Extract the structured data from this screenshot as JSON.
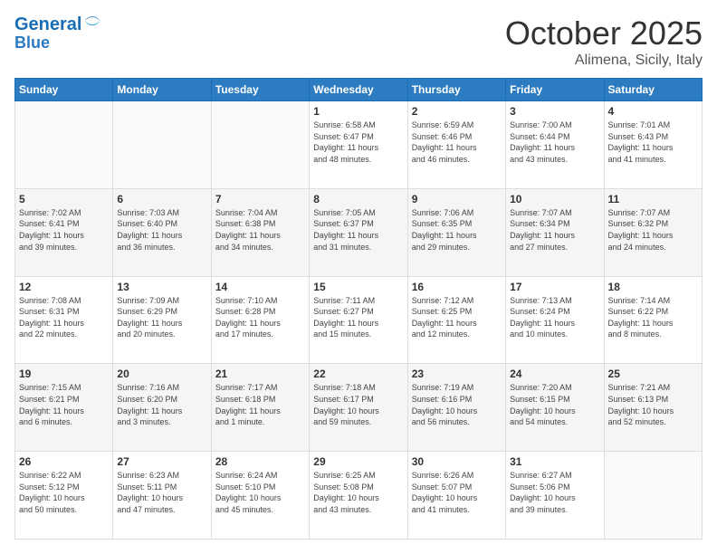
{
  "header": {
    "logo_line1": "General",
    "logo_line2": "Blue",
    "month": "October 2025",
    "location": "Alimena, Sicily, Italy"
  },
  "days_of_week": [
    "Sunday",
    "Monday",
    "Tuesday",
    "Wednesday",
    "Thursday",
    "Friday",
    "Saturday"
  ],
  "weeks": [
    [
      {
        "day": "",
        "info": ""
      },
      {
        "day": "",
        "info": ""
      },
      {
        "day": "",
        "info": ""
      },
      {
        "day": "1",
        "info": "Sunrise: 6:58 AM\nSunset: 6:47 PM\nDaylight: 11 hours\nand 48 minutes."
      },
      {
        "day": "2",
        "info": "Sunrise: 6:59 AM\nSunset: 6:46 PM\nDaylight: 11 hours\nand 46 minutes."
      },
      {
        "day": "3",
        "info": "Sunrise: 7:00 AM\nSunset: 6:44 PM\nDaylight: 11 hours\nand 43 minutes."
      },
      {
        "day": "4",
        "info": "Sunrise: 7:01 AM\nSunset: 6:43 PM\nDaylight: 11 hours\nand 41 minutes."
      }
    ],
    [
      {
        "day": "5",
        "info": "Sunrise: 7:02 AM\nSunset: 6:41 PM\nDaylight: 11 hours\nand 39 minutes."
      },
      {
        "day": "6",
        "info": "Sunrise: 7:03 AM\nSunset: 6:40 PM\nDaylight: 11 hours\nand 36 minutes."
      },
      {
        "day": "7",
        "info": "Sunrise: 7:04 AM\nSunset: 6:38 PM\nDaylight: 11 hours\nand 34 minutes."
      },
      {
        "day": "8",
        "info": "Sunrise: 7:05 AM\nSunset: 6:37 PM\nDaylight: 11 hours\nand 31 minutes."
      },
      {
        "day": "9",
        "info": "Sunrise: 7:06 AM\nSunset: 6:35 PM\nDaylight: 11 hours\nand 29 minutes."
      },
      {
        "day": "10",
        "info": "Sunrise: 7:07 AM\nSunset: 6:34 PM\nDaylight: 11 hours\nand 27 minutes."
      },
      {
        "day": "11",
        "info": "Sunrise: 7:07 AM\nSunset: 6:32 PM\nDaylight: 11 hours\nand 24 minutes."
      }
    ],
    [
      {
        "day": "12",
        "info": "Sunrise: 7:08 AM\nSunset: 6:31 PM\nDaylight: 11 hours\nand 22 minutes."
      },
      {
        "day": "13",
        "info": "Sunrise: 7:09 AM\nSunset: 6:29 PM\nDaylight: 11 hours\nand 20 minutes."
      },
      {
        "day": "14",
        "info": "Sunrise: 7:10 AM\nSunset: 6:28 PM\nDaylight: 11 hours\nand 17 minutes."
      },
      {
        "day": "15",
        "info": "Sunrise: 7:11 AM\nSunset: 6:27 PM\nDaylight: 11 hours\nand 15 minutes."
      },
      {
        "day": "16",
        "info": "Sunrise: 7:12 AM\nSunset: 6:25 PM\nDaylight: 11 hours\nand 12 minutes."
      },
      {
        "day": "17",
        "info": "Sunrise: 7:13 AM\nSunset: 6:24 PM\nDaylight: 11 hours\nand 10 minutes."
      },
      {
        "day": "18",
        "info": "Sunrise: 7:14 AM\nSunset: 6:22 PM\nDaylight: 11 hours\nand 8 minutes."
      }
    ],
    [
      {
        "day": "19",
        "info": "Sunrise: 7:15 AM\nSunset: 6:21 PM\nDaylight: 11 hours\nand 6 minutes."
      },
      {
        "day": "20",
        "info": "Sunrise: 7:16 AM\nSunset: 6:20 PM\nDaylight: 11 hours\nand 3 minutes."
      },
      {
        "day": "21",
        "info": "Sunrise: 7:17 AM\nSunset: 6:18 PM\nDaylight: 11 hours\nand 1 minute."
      },
      {
        "day": "22",
        "info": "Sunrise: 7:18 AM\nSunset: 6:17 PM\nDaylight: 10 hours\nand 59 minutes."
      },
      {
        "day": "23",
        "info": "Sunrise: 7:19 AM\nSunset: 6:16 PM\nDaylight: 10 hours\nand 56 minutes."
      },
      {
        "day": "24",
        "info": "Sunrise: 7:20 AM\nSunset: 6:15 PM\nDaylight: 10 hours\nand 54 minutes."
      },
      {
        "day": "25",
        "info": "Sunrise: 7:21 AM\nSunset: 6:13 PM\nDaylight: 10 hours\nand 52 minutes."
      }
    ],
    [
      {
        "day": "26",
        "info": "Sunrise: 6:22 AM\nSunset: 5:12 PM\nDaylight: 10 hours\nand 50 minutes."
      },
      {
        "day": "27",
        "info": "Sunrise: 6:23 AM\nSunset: 5:11 PM\nDaylight: 10 hours\nand 47 minutes."
      },
      {
        "day": "28",
        "info": "Sunrise: 6:24 AM\nSunset: 5:10 PM\nDaylight: 10 hours\nand 45 minutes."
      },
      {
        "day": "29",
        "info": "Sunrise: 6:25 AM\nSunset: 5:08 PM\nDaylight: 10 hours\nand 43 minutes."
      },
      {
        "day": "30",
        "info": "Sunrise: 6:26 AM\nSunset: 5:07 PM\nDaylight: 10 hours\nand 41 minutes."
      },
      {
        "day": "31",
        "info": "Sunrise: 6:27 AM\nSunset: 5:06 PM\nDaylight: 10 hours\nand 39 minutes."
      },
      {
        "day": "",
        "info": ""
      }
    ]
  ]
}
